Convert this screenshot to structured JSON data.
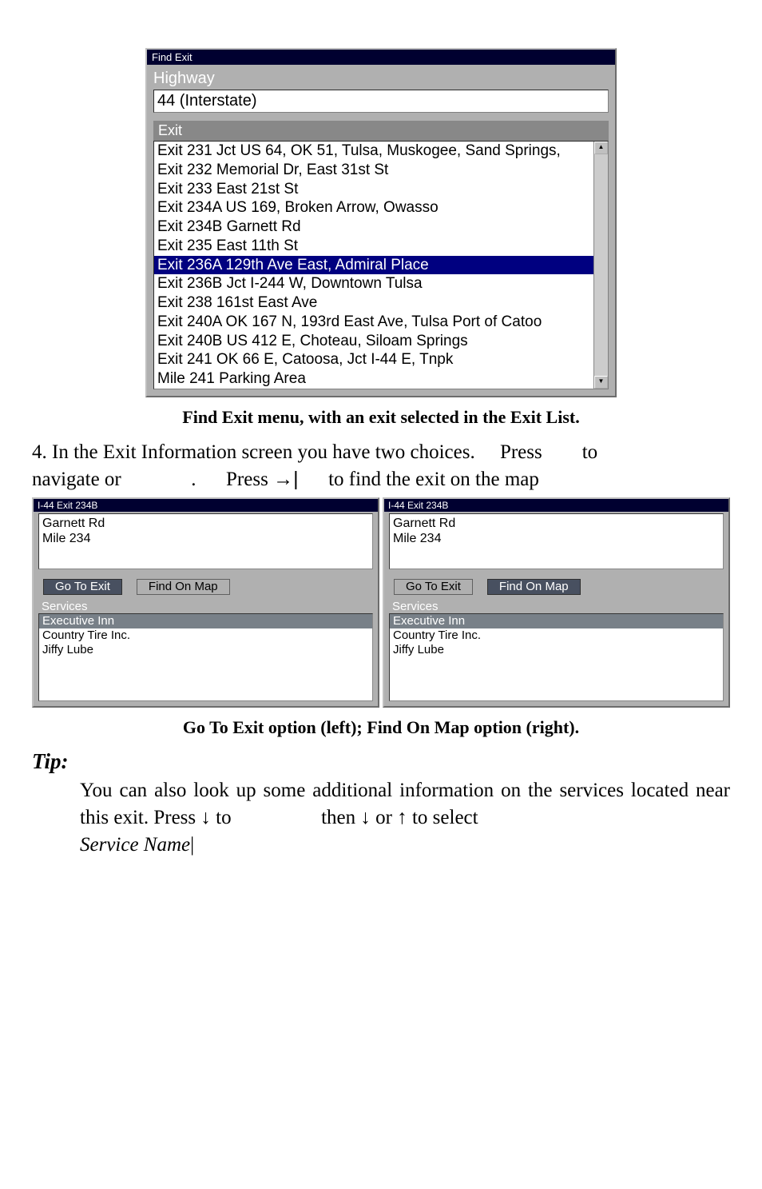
{
  "find_exit": {
    "window_title": "Find Exit",
    "highway_label": "Highway",
    "highway_value": "44 (Interstate)",
    "exit_header": "Exit",
    "items": [
      "Exit 231 Jct US 64, OK 51, Tulsa, Muskogee, Sand Springs,",
      "Exit 232 Memorial Dr, East 31st St",
      "Exit 233 East 21st St",
      "Exit 234A US 169, Broken Arrow, Owasso",
      "Exit 234B Garnett Rd",
      "Exit 235 East 11th St",
      "Exit 236A 129th Ave East, Admiral Place",
      "Exit 236B Jct I-244 W, Downtown Tulsa",
      "Exit 238 161st East Ave",
      "Exit 240A OK 167 N, 193rd East Ave, Tulsa Port of Catoo",
      "Exit 240B US 412 E, Choteau, Siloam Springs",
      "Exit 241 OK 66 E, Catoosa, Jct I-44 E, Tnpk",
      "Mile 241 Parking Area"
    ],
    "selected_index": 6
  },
  "caption1": "Find Exit menu, with an exit selected in the Exit List.",
  "step4": {
    "prefix": "4. In the Exit Information screen you have two choices.",
    "press_word": "Press",
    "to_word": "to",
    "nav_or": "navigate or",
    "period": ".",
    "press2": "Press",
    "arrow": "→|",
    "suffix": "to find the exit on the map"
  },
  "panel_left": {
    "title": "I-44 Exit 234B",
    "line1": "Garnett Rd",
    "line2": "Mile 234",
    "btn1": "Go To Exit",
    "btn2": "Find On Map",
    "services_label": "Services",
    "services": [
      "Executive Inn",
      "Country Tire Inc.",
      "Jiffy Lube"
    ]
  },
  "panel_right": {
    "title": "I-44 Exit 234B",
    "line1": "Garnett Rd",
    "line2": "Mile 234",
    "btn1": "Go To Exit",
    "btn2": "Find On Map",
    "services_label": "Services",
    "services": [
      "Executive Inn",
      "Country Tire Inc.",
      "Jiffy Lube"
    ]
  },
  "caption2": "Go To Exit option (left); Find On Map option (right).",
  "tip": {
    "heading": "Tip:",
    "l1_a": "You can also look up some additional information on the services",
    "l2_a": "located near this exit. Press",
    "l2_arrow1": "↓",
    "l2_to": "to",
    "l2_then": "then",
    "l2_arr_down": "↓",
    "l2_or": "or",
    "l2_arr_up": "↑",
    "l2_select": "to select",
    "l3_em": "Service Name",
    "l3_bar": "|"
  }
}
